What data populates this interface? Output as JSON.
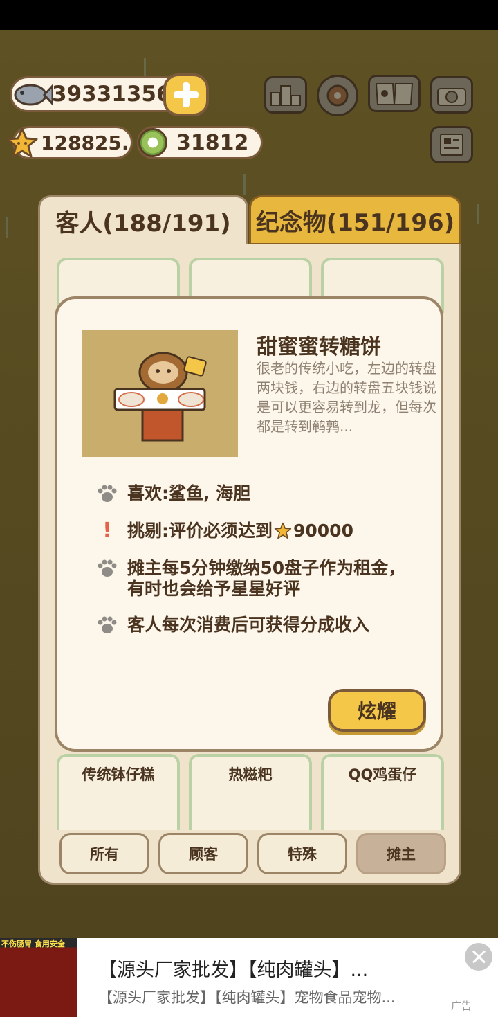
{
  "currency": {
    "fish": "39331356",
    "stars": "128825.",
    "coins": "31812"
  },
  "icons": {
    "add": "plus-icon",
    "ranking": "ranking-icon",
    "settings": "gear-icon",
    "guestbook": "book-icon",
    "camera": "camera-icon",
    "news": "newspaper-icon"
  },
  "tabs": {
    "guests": "客人(188/191)",
    "souvenirs": "纪念物(151/196)"
  },
  "cards_bottom": [
    {
      "name": "传统钵仔糕"
    },
    {
      "name": "热糍粑"
    },
    {
      "name": "QQ鸡蛋仔"
    }
  ],
  "filters": [
    "所有",
    "顾客",
    "特殊",
    "摊主"
  ],
  "modal": {
    "title": "甜蜜蜜转糖饼",
    "description": "很老的传统小吃，左边的转盘两块钱，右边的转盘五块钱说是可以更容易转到龙，但每次都是转到鹌鹑...",
    "likes": "喜欢:鲨鱼, 海胆",
    "picky_prefix": "挑剔:评价必须达到",
    "picky_value": "90000",
    "rent_line1": "摊主每5分钟缴纳50盘子作为租金，",
    "rent_line2": "有时也会给予星星好评",
    "share": "客人每次消费后可获得分成收入",
    "show_button": "炫耀"
  },
  "ad": {
    "image_caption": "不伤肠胃 食用安全",
    "title": "【源头厂家批发】【纯肉罐头】...",
    "subtitle": "【源头厂家批发】【纯肉罐头】宠物食品宠物...",
    "tag": "广告"
  },
  "colors": {
    "accent_yellow": "#f5c748",
    "panel_bg": "#efe3cb",
    "border_brown": "#7a5a3a"
  }
}
